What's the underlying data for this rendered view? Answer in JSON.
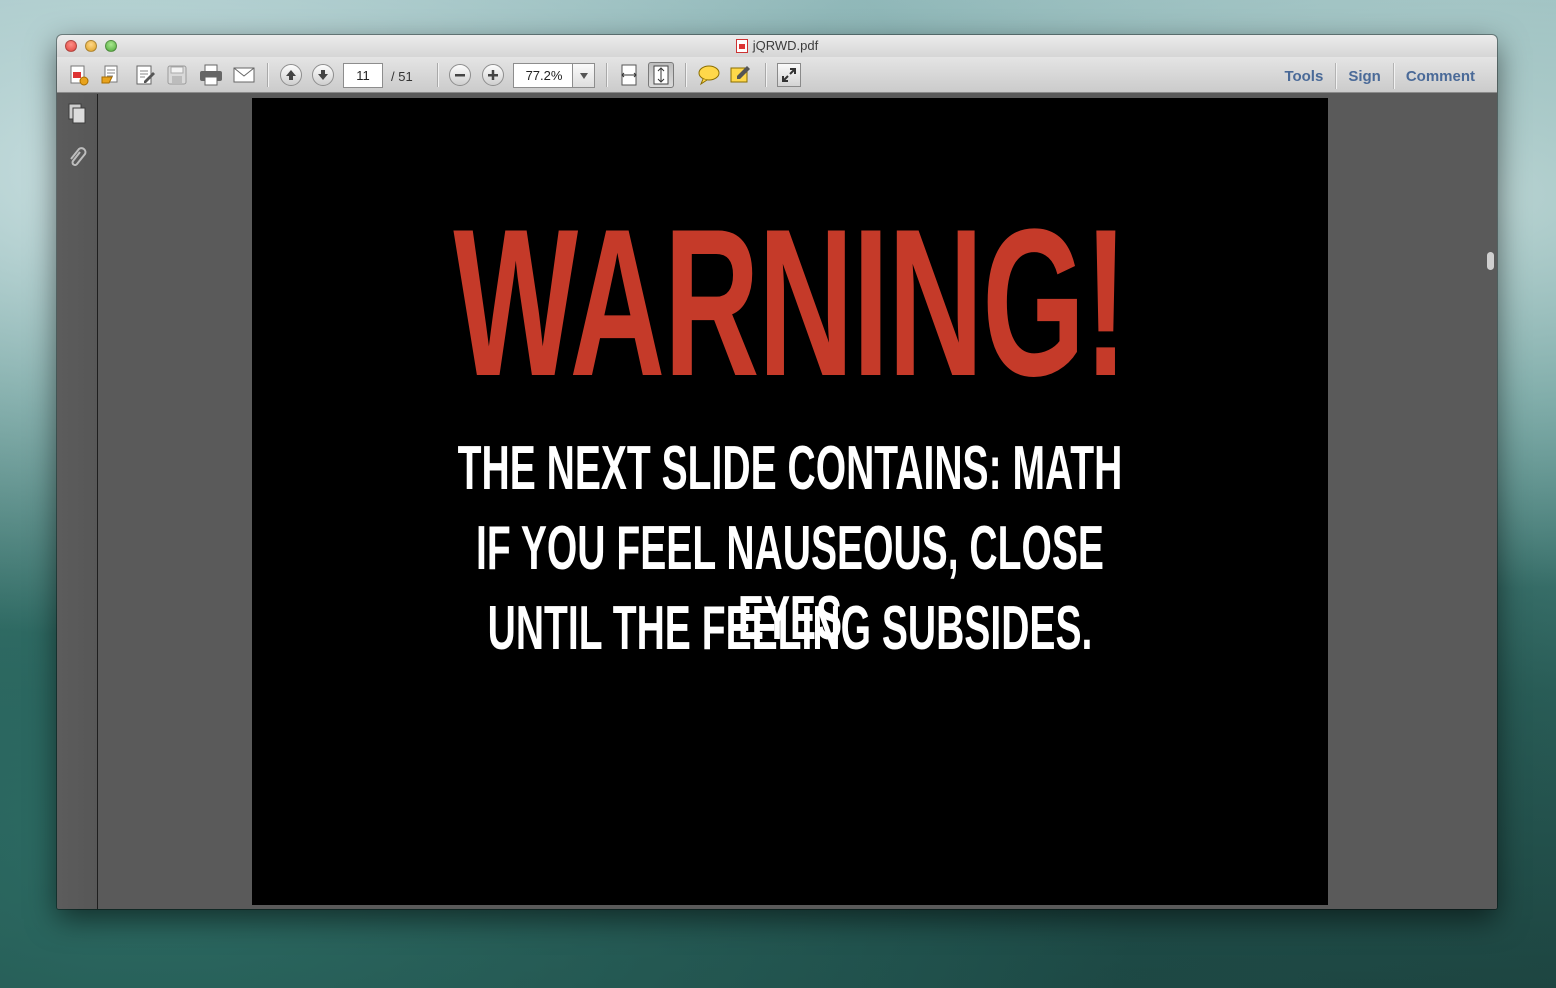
{
  "window": {
    "title": "jQRWD.pdf"
  },
  "toolbar": {
    "current_page": "11",
    "page_total": "/ 51",
    "zoom": "77.2%",
    "right_links": {
      "tools": "Tools",
      "sign": "Sign",
      "comment": "Comment"
    },
    "icons": [
      "create-pdf-icon",
      "open-icon",
      "edit-icon",
      "save-icon",
      "print-icon",
      "email-icon",
      "previous-page-icon",
      "next-page-icon",
      "zoom-out-icon",
      "zoom-in-icon",
      "fit-width-icon",
      "fit-page-icon",
      "sticky-note-icon",
      "highlight-icon",
      "fullscreen-icon"
    ]
  },
  "sidebar": {
    "icons": [
      "pages-icon",
      "attachments-icon"
    ]
  },
  "slide": {
    "headline": "WARNING!",
    "lines": [
      "THE NEXT SLIDE CONTAINS: MATH",
      "IF YOU FEEL NAUSEOUS, CLOSE EYES",
      "UNTIL THE FEELING SUBSIDES."
    ],
    "headline_color": "#c53a29",
    "text_color": "#ffffff",
    "background_color": "#000000"
  }
}
